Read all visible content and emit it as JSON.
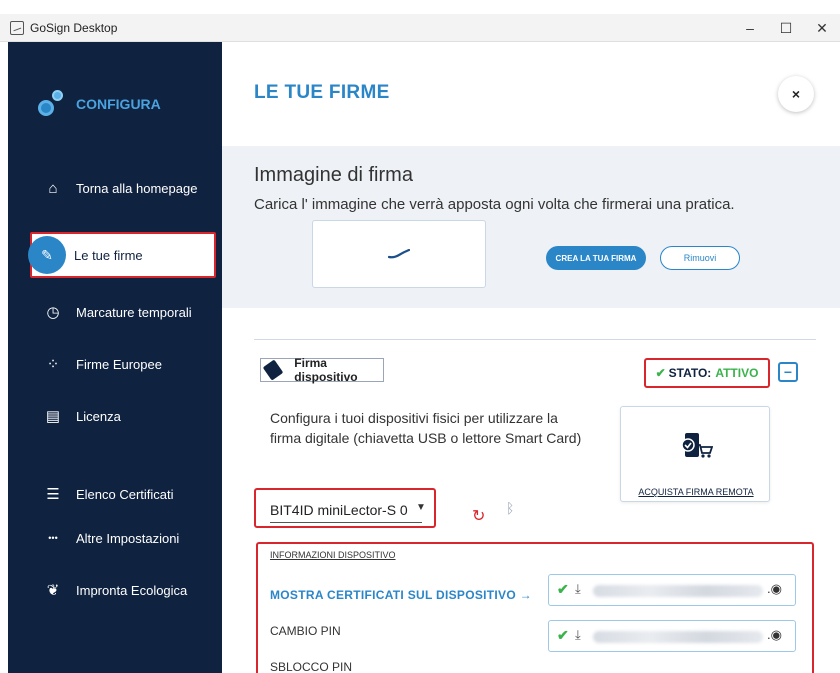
{
  "window": {
    "title": "GoSign Desktop",
    "minimize": "–",
    "maximize": "☐",
    "close": "✕"
  },
  "sidebar": {
    "logo_text": "CONFIGURA",
    "items": [
      {
        "label": "Torna alla homepage",
        "icon": "home-icon",
        "glyph": "⌂"
      },
      {
        "label": "Le tue firme",
        "icon": "signature-pen-icon",
        "glyph": "✎",
        "active": true
      },
      {
        "label": "Marcature temporali",
        "icon": "clock-icon",
        "glyph": "◷"
      },
      {
        "label": "Firme Europee",
        "icon": "eu-stars-icon",
        "glyph": "⁘"
      },
      {
        "label": "Licenza",
        "icon": "license-icon",
        "glyph": "▤"
      },
      {
        "label": "Elenco Certificati",
        "icon": "list-icon",
        "glyph": "☰"
      },
      {
        "label": "Altre Impostazioni",
        "icon": "more-icon",
        "glyph": "•••"
      },
      {
        "label": "Impronta Ecologica",
        "icon": "leaf-icon",
        "glyph": "❦"
      }
    ]
  },
  "main": {
    "title": "LE TUE FIRME",
    "close_glyph": "×",
    "signature_image": {
      "title": "Immagine di firma",
      "subtitle": "Carica l' immagine che verrà apposta ogni volta che firmerai una pratica.",
      "create_button": "CREA LA TUA FIRMA",
      "remove_button": "Rimuovi"
    },
    "device_signature": {
      "label": "Firma dispositivo",
      "status_prefix": "STATO:",
      "status_value": "ATTIVO",
      "description": "Configura i tuoi dispositivi fisici per utilizzare la firma digitale (chiavetta USB o lettore Smart Card)",
      "remote_label": "ACQUISTA FIRMA REMOTA",
      "selected_device": "BIT4ID miniLector-S 0"
    },
    "device_info": {
      "title": "INFORMAZIONI DISPOSITIVO",
      "show_certs": "MOSTRA CERTIFICATI SUL DISPOSITIVO  →",
      "change_pin": "CAMBIO PIN",
      "unlock_pin": "SBLOCCO PIN",
      "cert_suffix": ".",
      "eye_glyph": "◉"
    }
  },
  "colors": {
    "sidebar_bg": "#0f2240",
    "accent": "#2b86c8",
    "highlight_border": "#d9262c",
    "status_green": "#3ab34a"
  }
}
